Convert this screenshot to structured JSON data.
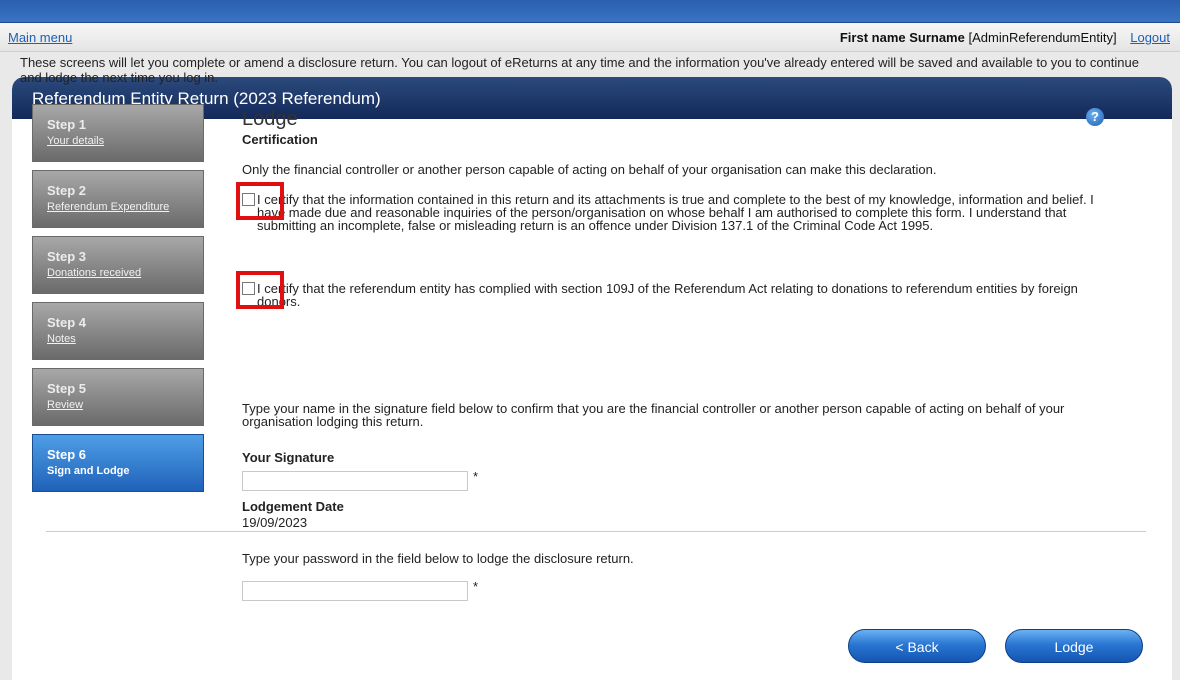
{
  "nav": {
    "main_menu": "Main menu",
    "user_name": "First name Surname",
    "user_role": "[AdminReferendumEntity]",
    "logout": "Logout"
  },
  "panel": {
    "title": "Referendum Entity Return (2023 Referendum)",
    "intro": "These screens will let you complete or amend a disclosure return. You can logout of eReturns at any time and the information you've already entered will be saved and available to you to continue and lodge the next time you log in."
  },
  "steps": [
    {
      "number": "Step 1",
      "label": "Your details"
    },
    {
      "number": "Step 2",
      "label": "Referendum Expenditure"
    },
    {
      "number": "Step 3",
      "label": "Donations received"
    },
    {
      "number": "Step 4",
      "label": "Notes"
    },
    {
      "number": "Step 5",
      "label": "Review"
    },
    {
      "number": "Step 6",
      "label": "Sign and Lodge",
      "active": true
    }
  ],
  "lodge": {
    "title": "Lodge",
    "help_icon": "help-icon",
    "certification_heading": "Certification",
    "only_text": "Only the financial controller or another person capable of acting on behalf of your organisation can make this declaration.",
    "certify_1": "I certify that the information contained in this return and its attachments is true and complete to the best of my knowledge, information and belief. I have made due and reasonable inquiries of the person/organisation on whose behalf I am authorised to complete this form. I understand that submitting an incomplete, false or misleading return is an offence under Division 137.1 of the Criminal Code Act 1995.",
    "certify_2": "I certify that the referendum entity has complied with section 109J of the Referendum Act relating to donations to referendum entities by foreign donors.",
    "signature_instruction": "Type your name in the signature field below to confirm that you are the financial controller or another person capable of acting on behalf of your organisation lodging this return.",
    "signature_label": "Your Signature",
    "signature_value": "",
    "required_mark": "*",
    "date_label": "Lodgement Date",
    "date_value": "19/09/2023",
    "password_instruction": "Type your password in the field below to lodge the disclosure return.",
    "password_value": ""
  },
  "buttons": {
    "back": "< Back",
    "lodge": "Lodge"
  },
  "colors": {
    "highlight": "#e01010",
    "header_bg": "#13295a",
    "button": "#2a76d3"
  }
}
